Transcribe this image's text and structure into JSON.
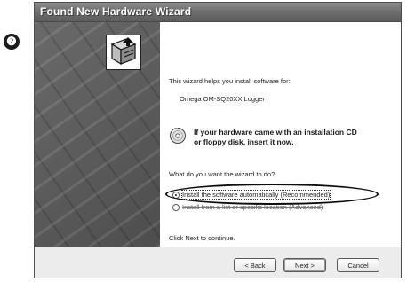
{
  "step_badge": "❷",
  "window": {
    "title": "Found New Hardware Wizard"
  },
  "banner": {
    "icon": "hardware-installer-icon"
  },
  "content": {
    "intro": "This wizard helps you install software for:",
    "device_name": "Omega OM-SQ20XX Logger",
    "cd_icon": "cd-icon",
    "cd_prompt_line1": "If your hardware came with an installation CD",
    "cd_prompt_line2": "or floppy disk, insert it now.",
    "question": "What do you want the wizard to do?",
    "options": [
      {
        "label": "Install the software automatically (Recommended)",
        "selected": true
      },
      {
        "label": "Install from a list or specific location (Advanced)",
        "selected": false
      }
    ],
    "continue_text": "Click Next to continue."
  },
  "buttons": {
    "back": "< Back",
    "next": "Next >",
    "cancel": "Cancel"
  }
}
